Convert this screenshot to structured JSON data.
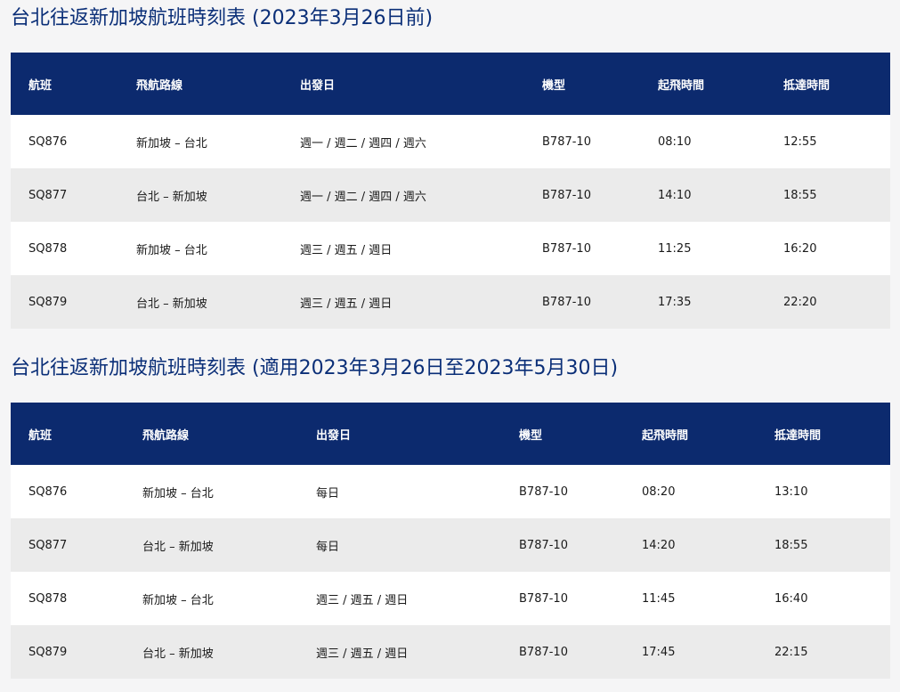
{
  "sections": [
    {
      "title": "台北往返新加坡航班時刻表 (2023年3月26日前)",
      "headers": [
        "航班",
        "飛航路線",
        "出發日",
        "機型",
        "起飛時間",
        "抵達時間"
      ],
      "rows": [
        [
          "SQ876",
          "新加坡 – 台北",
          "週一 / 週二 / 週四 / 週六",
          "B787-10",
          "08:10",
          "12:55"
        ],
        [
          "SQ877",
          "台北 – 新加坡",
          "週一 / 週二 / 週四 / 週六",
          "B787-10",
          "14:10",
          "18:55"
        ],
        [
          "SQ878",
          "新加坡 – 台北",
          "週三 / 週五 / 週日",
          "B787-10",
          "11:25",
          "16:20"
        ],
        [
          "SQ879",
          "台北 – 新加坡",
          "週三 / 週五 / 週日",
          "B787-10",
          "17:35",
          "22:20"
        ]
      ]
    },
    {
      "title": "台北往返新加坡航班時刻表 (適用2023年3月26日至2023年5月30日)",
      "headers": [
        "航班",
        "飛航路線",
        "出發日",
        "機型",
        "起飛時間",
        "抵達時間"
      ],
      "rows": [
        [
          "SQ876",
          "新加坡 – 台北",
          "每日",
          "B787-10",
          "08:20",
          "13:10"
        ],
        [
          "SQ877",
          "台北 – 新加坡",
          "每日",
          "B787-10",
          "14:20",
          "18:55"
        ],
        [
          "SQ878",
          "新加坡 – 台北",
          "週三 / 週五 / 週日",
          "B787-10",
          "11:45",
          "16:40"
        ],
        [
          "SQ879",
          "台北 – 新加坡",
          "週三 / 週五 / 週日",
          "B787-10",
          "17:45",
          "22:15"
        ]
      ]
    }
  ],
  "colors": {
    "title": "#0b2f78",
    "header_bg": "#0c2a6e",
    "header_text": "#ffffff",
    "row_white": "#ffffff",
    "row_gray": "#ebebeb"
  }
}
